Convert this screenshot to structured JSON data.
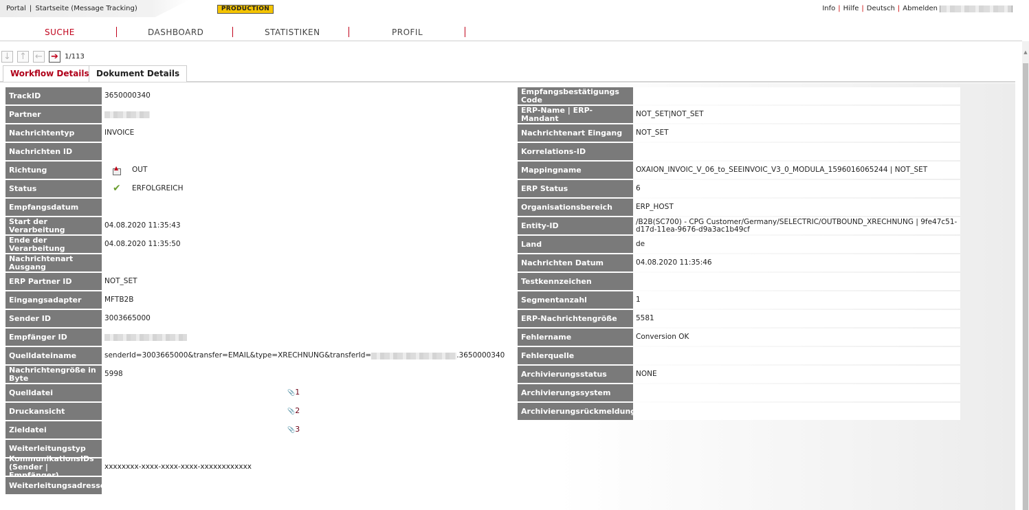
{
  "header": {
    "breadcrumb": [
      "Portal",
      "|",
      "Startseite (Message Tracking)"
    ],
    "environment_badge": "PRODUCTION",
    "links": [
      "Info",
      "Hilfe",
      "Deutsch",
      "Abmelden"
    ]
  },
  "nav": {
    "items": [
      "SUCHE",
      "DASHBOARD",
      "STATISTIKEN",
      "PROFIL"
    ],
    "active": "SUCHE"
  },
  "pager": {
    "text": "1/113"
  },
  "tabs": [
    "Workflow Details",
    "Dokument Details"
  ],
  "left_details": [
    {
      "label": "TrackID",
      "value": "3650000340"
    },
    {
      "label": "Partner",
      "value": ""
    },
    {
      "label": "Nachrichtentyp",
      "value": "INVOICE"
    },
    {
      "label": "Nachrichten ID",
      "value": ""
    },
    {
      "label": "Richtung",
      "value": "OUT",
      "icon": "outbound-icon"
    },
    {
      "label": "Status",
      "value": "ERFOLGREICH",
      "icon": "checkmark-icon"
    },
    {
      "label": "Empfangsdatum",
      "value": ""
    },
    {
      "label": "Start der Verarbeitung",
      "value": "04.08.2020 11:35:43"
    },
    {
      "label": "Ende der Verarbeitung",
      "value": "04.08.2020 11:35:50"
    },
    {
      "label": "Nachrichtenart Ausgang",
      "value": ""
    },
    {
      "label": "ERP Partner ID",
      "value": "NOT_SET"
    },
    {
      "label": "Eingangsadapter",
      "value": "MFTB2B"
    },
    {
      "label": "Sender ID",
      "value": "3003665000"
    },
    {
      "label": "Empfänger ID",
      "value": ""
    },
    {
      "label": "Quelldateiname",
      "value_prefix": "senderId=3003665000&transfer=EMAIL&type=XRECHNUNG&transferId=",
      "value_suffix": ".3650000340"
    },
    {
      "label": "Nachrichtengröße in Byte",
      "value": "5998"
    },
    {
      "label": "Quelldatei",
      "attachment": "1"
    },
    {
      "label": "Druckansicht",
      "attachment": "2"
    },
    {
      "label": "Zieldatei",
      "attachment": "3"
    },
    {
      "label": "Weiterleitungstyp",
      "value": ""
    },
    {
      "label": "KommunikationsIDs (Sender | Empfänger)",
      "value": "xxxxxxxx-xxxx-xxxx-xxxx-xxxxxxxxxxxx"
    },
    {
      "label": "Weiterleitungsadresse",
      "value": ""
    }
  ],
  "right_details": [
    {
      "label": "Empfangsbestätigungs Code",
      "value": ""
    },
    {
      "label": "ERP-Name | ERP-Mandant",
      "value": "NOT_SET|NOT_SET"
    },
    {
      "label": "Nachrichtenart Eingang",
      "value": "NOT_SET"
    },
    {
      "label": "Korrelations-ID",
      "value": ""
    },
    {
      "label": "Mappingname",
      "value": "OXAION_INVOIC_V_06_to_SEEINVOIC_V3_0_MODULA_1596016065244 | NOT_SET"
    },
    {
      "label": "ERP Status",
      "value": "6"
    },
    {
      "label": "Organisationsbereich",
      "value": "ERP_HOST"
    },
    {
      "label": "Entity-ID",
      "value": "/B2B(SC700) - CPG Customer/Germany/SELECTRIC/OUTBOUND_XRECHNUNG | 9fe47c51-d17d-11ea-9676-d9a3ac1b49cf"
    },
    {
      "label": "Land",
      "value": "de"
    },
    {
      "label": "Nachrichten Datum",
      "value": "04.08.2020 11:35:46"
    },
    {
      "label": "Testkennzeichen",
      "value": ""
    },
    {
      "label": "Segmentanzahl",
      "value": "1"
    },
    {
      "label": "ERP-Nachrichtengröße",
      "value": "5581"
    },
    {
      "label": "Fehlername",
      "value": "Conversion OK"
    },
    {
      "label": "Fehlerquelle",
      "value": ""
    },
    {
      "label": "Archivierungsstatus",
      "value": "NONE"
    },
    {
      "label": "Archivierungssystem",
      "value": ""
    },
    {
      "label": "Archivierungsrückmeldung",
      "value": ""
    }
  ],
  "colors": {
    "accent": "#c0001a",
    "label_bg": "#7a7a7a",
    "badge": "#f5c400"
  }
}
